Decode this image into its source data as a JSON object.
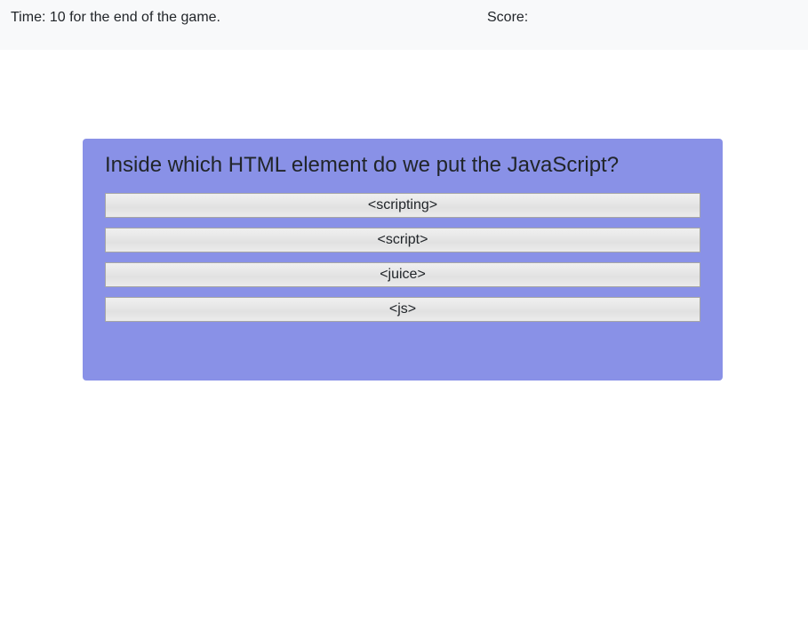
{
  "header": {
    "timer_text": "Time: 10 for the end of the game.",
    "score_text": "Score:"
  },
  "quiz": {
    "question": "Inside which HTML element do we put the JavaScript?",
    "answers": [
      {
        "label": "<scripting>"
      },
      {
        "label": "<script>"
      },
      {
        "label": "<juice>"
      },
      {
        "label": "<js>"
      }
    ]
  },
  "colors": {
    "card_background": "#8991e7",
    "header_background": "#f8f9fa",
    "text": "#212529"
  }
}
